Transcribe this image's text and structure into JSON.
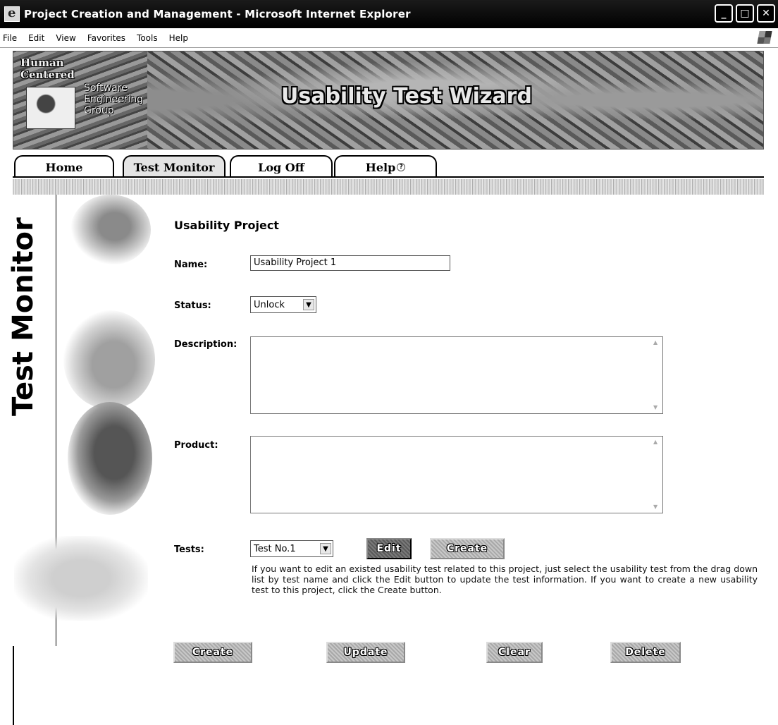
{
  "window": {
    "title": "Project Creation and Management - Microsoft Internet Explorer",
    "controls": [
      "_",
      "□",
      "✕"
    ]
  },
  "menu": [
    "File",
    "Edit",
    "View",
    "Favorites",
    "Tools",
    "Help"
  ],
  "banner": {
    "logo_line1": "Human",
    "logo_line2": "Centered",
    "logo_line3": "Software",
    "logo_line4": "Engineering",
    "logo_line5": "Group",
    "title": "Usability Test Wizard"
  },
  "tabs": [
    {
      "label": "Home"
    },
    {
      "label": "Test Monitor",
      "active": true
    },
    {
      "label": "Log Off"
    },
    {
      "label": "Help"
    }
  ],
  "sidebar_title": "Test Monitor",
  "form": {
    "section_title": "Usability Project",
    "name_label": "Name:",
    "name_value": "Usability Project 1",
    "status_label": "Status:",
    "status_value": "Unlock",
    "description_label": "Description:",
    "description_value": "",
    "product_label": "Product:",
    "product_value": "",
    "tests_label": "Tests:",
    "tests_value": "Test No.1",
    "edit_label": "Edit",
    "create_test_label": "Create",
    "help_text": "If you want to edit an existed usability test related to this project, just select the usability test from the drag down list by test name and click the Edit button to update the test information. If you want to create a new usability test to this project, click the Create button."
  },
  "actions": {
    "create": "Create",
    "update": "Update",
    "clear": "Clear",
    "delete": "Delete"
  }
}
